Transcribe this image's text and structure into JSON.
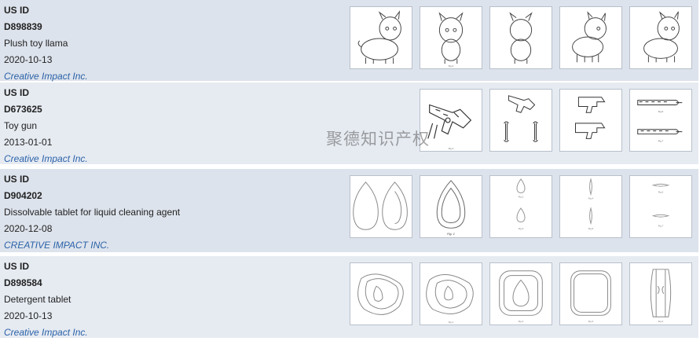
{
  "results": [
    {
      "label": "US ID",
      "patent_number": "D898839",
      "title": "Plush toy llama",
      "date": "2020-10-13",
      "assignee": "Creative Impact Inc."
    },
    {
      "label": "US ID",
      "patent_number": "D673625",
      "title": "Toy gun",
      "date": "2013-01-01",
      "assignee": "Creative Impact Inc."
    },
    {
      "label": "US ID",
      "patent_number": "D904202",
      "title": "Dissolvable tablet for liquid cleaning agent",
      "date": "2020-12-08",
      "assignee": "CREATIVE IMPACT INC."
    },
    {
      "label": "US ID",
      "patent_number": "D898584",
      "title": "Detergent tablet",
      "date": "2020-10-13",
      "assignee": "Creative Impact Inc."
    }
  ],
  "watermark": "聚德知识产权",
  "colors": {
    "row_bg": "#dde3ec",
    "assignee": "#2b62a8"
  }
}
